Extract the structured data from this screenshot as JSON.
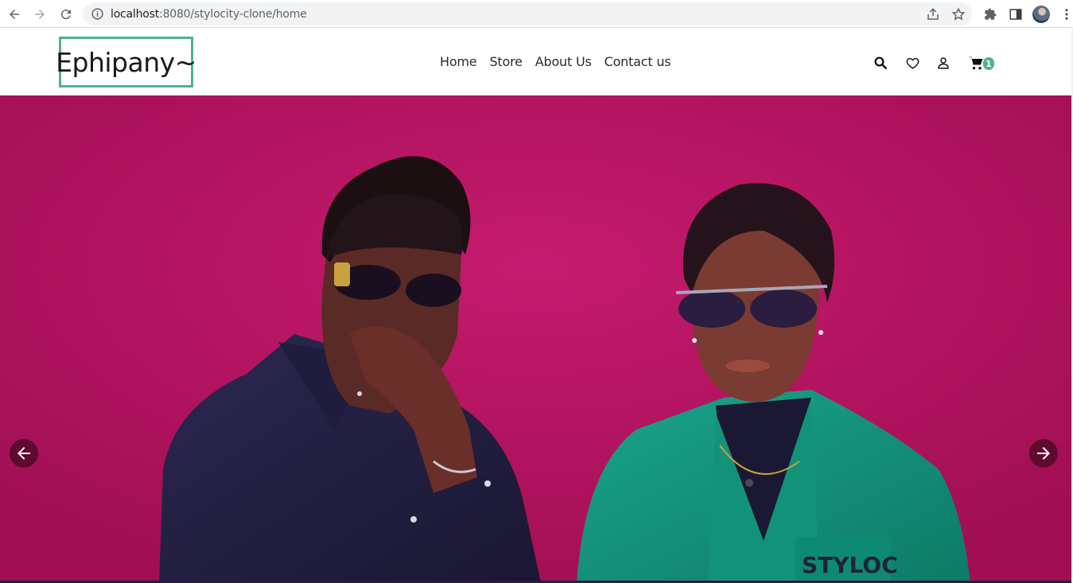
{
  "browser": {
    "url_host": "localhost",
    "url_rest": ":8080/stylocity-clone/home"
  },
  "header": {
    "logo": "Ephipany~",
    "nav": [
      {
        "label": "Home"
      },
      {
        "label": "Store"
      },
      {
        "label": "About Us"
      },
      {
        "label": "Contact us"
      }
    ],
    "icons": [
      "search-icon",
      "heart-icon",
      "user-icon",
      "cart-icon"
    ],
    "cart_count": "1"
  },
  "hero": {
    "shirt_text": "STYLOC"
  },
  "colors": {
    "accent": "#4cb29b",
    "hero_bg": "#b0125c",
    "arrow_bg": "#5e0a2f"
  }
}
